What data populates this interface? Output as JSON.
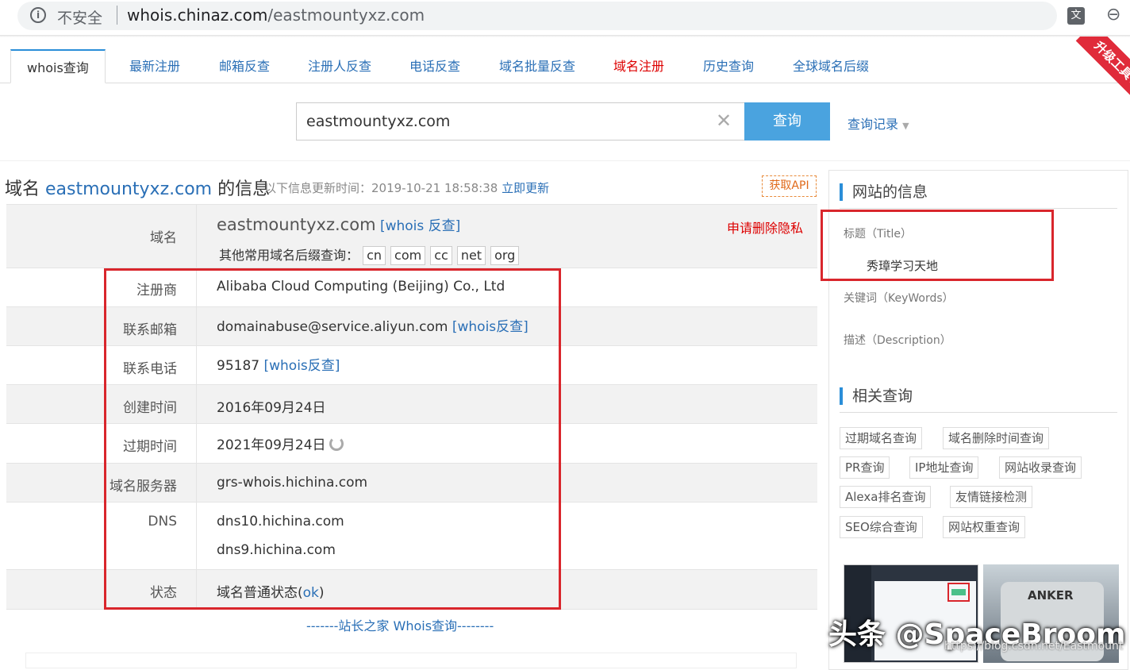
{
  "browser": {
    "insecure_label": "不安全",
    "url_host": "whois.chinaz.com",
    "url_path": "/eastmountyxz.com",
    "translate_icon": "translate-icon",
    "zoom_icon": "zoom-icon"
  },
  "tabs": [
    {
      "label": "whois查询"
    },
    {
      "label": "最新注册"
    },
    {
      "label": "邮箱反查"
    },
    {
      "label": "注册人反查"
    },
    {
      "label": "电话反查"
    },
    {
      "label": "域名批量反查"
    },
    {
      "label": "域名注册"
    },
    {
      "label": "历史查询"
    },
    {
      "label": "全球域名后缀"
    }
  ],
  "ribbon": "升级工具VIP",
  "search": {
    "value": "eastmountyxz.com",
    "button": "查询",
    "history": "查询记录"
  },
  "info": {
    "title_prefix": "域名",
    "domain": "eastmountyxz.com",
    "title_suffix": "的信息",
    "updated_text": "以下信息更新时间：2019-10-21 18:58:38",
    "refresh_link": "立即更新",
    "api_button": "获取API"
  },
  "whois": {
    "domain_label": "域名",
    "domain_value": "eastmountyxz.com",
    "domain_link": "[whois 反查]",
    "delete_privacy": "申请删除隐私",
    "suffix_label": "其他常用域名后缀查询：",
    "suffixes": [
      "cn",
      "com",
      "cc",
      "net",
      "org"
    ],
    "registrar_label": "注册商",
    "registrar_value": "Alibaba Cloud Computing (Beijing) Co., Ltd",
    "email_label": "联系邮箱",
    "email_value": "domainabuse@service.aliyun.com",
    "email_link": "[whois反查]",
    "phone_label": "联系电话",
    "phone_value": "95187",
    "phone_link": "[whois反查]",
    "created_label": "创建时间",
    "created_value": "2016年09月24日",
    "expire_label": "过期时间",
    "expire_value": "2021年09月24日",
    "server_label": "域名服务器",
    "server_value": "grs-whois.hichina.com",
    "dns_label": "DNS",
    "dns_values": [
      "dns10.hichina.com",
      "dns9.hichina.com"
    ],
    "status_label": "状态",
    "status_prefix": "域名普通状态(",
    "status_link": "ok",
    "status_suffix": ")"
  },
  "footer_link": "-------站长之家 Whois查询--------",
  "site_info": {
    "heading": "网站的信息",
    "title_key": "标题（Title）",
    "title_value": "秀璋学习天地",
    "keywords_key": "关键词（KeyWords）",
    "description_key": "描述（Description）"
  },
  "related": {
    "heading": "相关查询",
    "tags": [
      "过期域名查询",
      "域名删除时间查询",
      "PR查询",
      "IP地址查询",
      "网站收录查询",
      "Alexa排名查询",
      "友情链接检测",
      "SEO综合查询",
      "网站权重查询"
    ]
  },
  "thumb2_logo": "ANKER",
  "watermark": "头条 @SpaceBroom",
  "watermark_url": "https://blog.csdn.net/Eastmount",
  "colors": {
    "link": "#2a6fb6",
    "accent": "#4aa3df",
    "highlight": "#d9262c"
  }
}
